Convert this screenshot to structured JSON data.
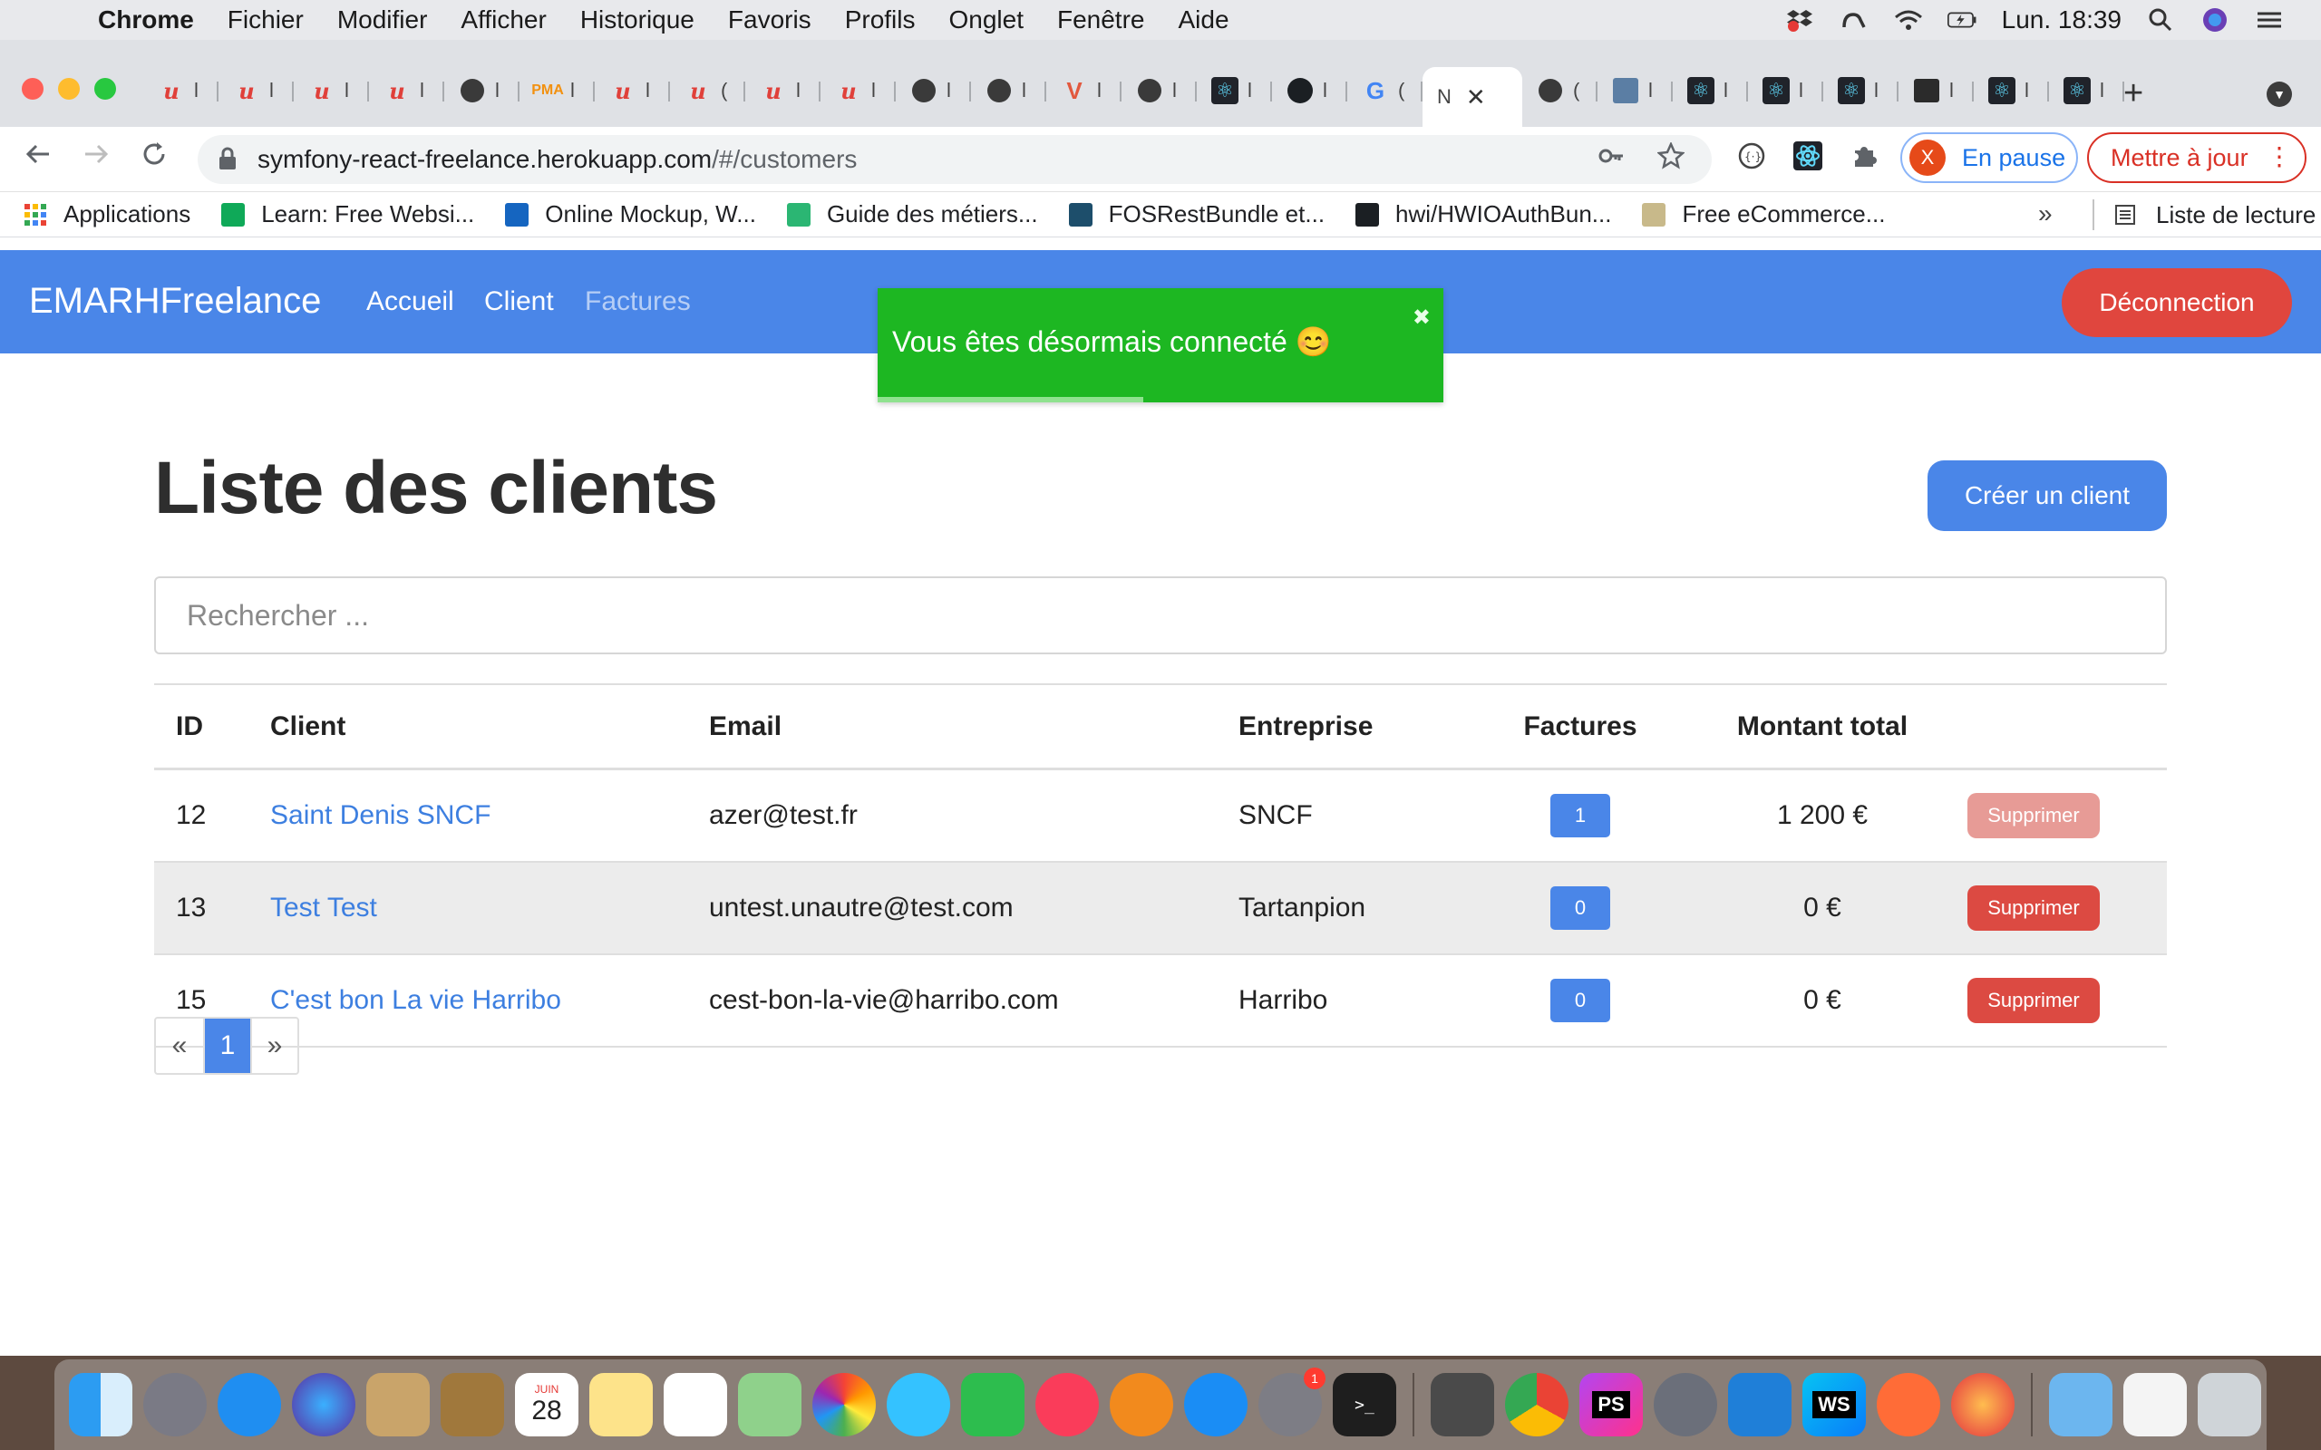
{
  "menubar": {
    "apple": "",
    "items": [
      "Chrome",
      "Fichier",
      "Modifier",
      "Afficher",
      "Historique",
      "Favoris",
      "Profils",
      "Onglet",
      "Fenêtre",
      "Aide"
    ],
    "clock": "Lun. 18:39",
    "icons": [
      "dropbox-icon",
      "creative-cloud-icon",
      "wifi-icon",
      "battery-icon",
      "spotlight-icon",
      "siri-icon",
      "control-center-icon"
    ]
  },
  "browser": {
    "active_tab_letter": "N",
    "tabs": [
      {
        "icon": "udemy",
        "letter": "l"
      },
      {
        "icon": "udemy",
        "letter": "l"
      },
      {
        "icon": "udemy",
        "letter": "l"
      },
      {
        "icon": "udemy",
        "letter": "l"
      },
      {
        "icon": "globe",
        "letter": "l"
      },
      {
        "icon": "phpmyadmin",
        "letter": "l"
      },
      {
        "icon": "udemy",
        "letter": "l"
      },
      {
        "icon": "udemy",
        "letter": "("
      },
      {
        "icon": "udemy",
        "letter": "l"
      },
      {
        "icon": "udemy",
        "letter": "l"
      },
      {
        "icon": "globe",
        "letter": "l"
      },
      {
        "icon": "globe",
        "letter": "l"
      },
      {
        "icon": "vue",
        "letter": "l"
      },
      {
        "icon": "globe",
        "letter": "l"
      },
      {
        "icon": "react",
        "letter": "l"
      },
      {
        "icon": "github",
        "letter": "l"
      },
      {
        "icon": "google",
        "letter": "("
      }
    ],
    "tabs_after": [
      {
        "icon": "globe",
        "letter": "("
      },
      {
        "icon": "person",
        "letter": "l"
      },
      {
        "icon": "react",
        "letter": "l"
      },
      {
        "icon": "react",
        "letter": "l"
      },
      {
        "icon": "react",
        "letter": "l"
      },
      {
        "icon": "dark",
        "letter": "l"
      },
      {
        "icon": "react",
        "letter": "l"
      },
      {
        "icon": "react",
        "letter": "l"
      }
    ],
    "url_host": "symfony-react-freelance.herokuapp.com",
    "url_path": "/#/customers",
    "profile_initial": "X",
    "profile_label": "En pause",
    "update_label": "Mettre à jour"
  },
  "bookmarks": [
    {
      "label": "Applications",
      "icon": "apps-grid-icon",
      "color": "#ea4335"
    },
    {
      "label": "Learn: Free Websi...",
      "icon": "framer-icon",
      "color": "#0fa958"
    },
    {
      "label": "Online Mockup, W...",
      "icon": "moqups-icon",
      "color": "#1565c0"
    },
    {
      "label": "Guide des métiers...",
      "icon": "w-icon",
      "color": "#2bb673"
    },
    {
      "label": "FOSRestBundle et...",
      "icon": "oc-icon",
      "color": "#1d4e6b"
    },
    {
      "label": "hwi/HWIOAuthBun...",
      "icon": "github-icon",
      "color": "#1b1f23"
    },
    {
      "label": "Free eCommerce...",
      "icon": "css-icon",
      "color": "#c8b98a"
    }
  ],
  "bookmarks_more": "»",
  "reading_list": "Liste de lecture",
  "app": {
    "brand": "EMARHFreelance",
    "nav": {
      "home": "Accueil",
      "customers": "Client",
      "invoices": "Factures"
    },
    "logout": "Déconnection",
    "toast": {
      "message": "Vous êtes désormais connecté 😊",
      "close": "✖",
      "progress": 0.47
    },
    "title": "Liste des clients",
    "create_button": "Créer un client",
    "search_placeholder": "Rechercher ...",
    "table": {
      "headers": {
        "id": "ID",
        "client": "Client",
        "email": "Email",
        "company": "Entreprise",
        "invoices": "Factures",
        "total": "Montant total"
      },
      "rows": [
        {
          "id": "12",
          "client": "Saint Denis SNCF",
          "email": "azer@test.fr",
          "company": "SNCF",
          "invoices": "1",
          "total": "1 200 €",
          "delete": "Supprimer"
        },
        {
          "id": "13",
          "client": "Test Test",
          "email": "untest.unautre@test.com",
          "company": "Tartanpion",
          "invoices": "0",
          "total": "0 €",
          "delete": "Supprimer"
        },
        {
          "id": "15",
          "client": "C'est bon La vie Harribo",
          "email": "cest-bon-la-vie@harribo.com",
          "company": "Harribo",
          "invoices": "0",
          "total": "0 €",
          "delete": "Supprimer"
        }
      ]
    },
    "pagination": {
      "prev": "«",
      "current": "1",
      "next": "»"
    }
  },
  "dock": {
    "calendar_month": "JUIN",
    "calendar_day": "28",
    "settings_badge": "1",
    "terminal_prompt": ">_",
    "phpstorm": "PS",
    "webstorm": "WS",
    "apps": [
      "finder-icon",
      "launchpad-icon",
      "safari-icon",
      "siri-icon",
      "mail-icon",
      "contacts-icon",
      "calendar-icon",
      "notes-icon",
      "reminders-icon",
      "maps-icon",
      "photos-icon",
      "messages-icon",
      "facetime-icon",
      "music-icon",
      "books-icon",
      "app-store-icon",
      "system-preferences-icon",
      "terminal-icon",
      "sublime-text-icon",
      "chrome-icon",
      "phpstorm-icon",
      "tableplus-icon",
      "vscode-icon",
      "webstorm-icon",
      "postman-icon",
      "firefox-icon",
      "downloads-folder-icon",
      "document-icon",
      "trash-icon"
    ]
  }
}
